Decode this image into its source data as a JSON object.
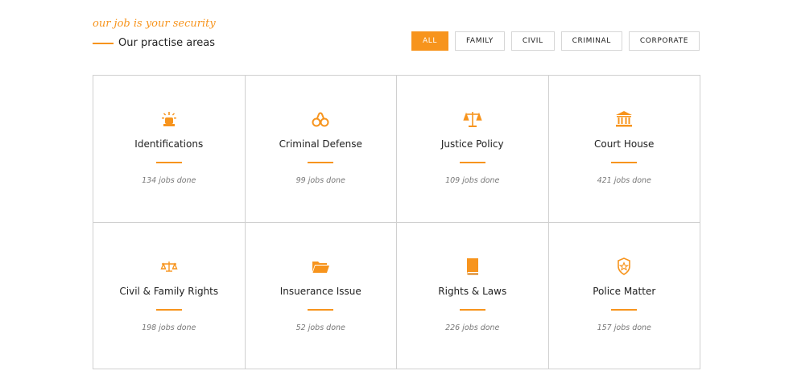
{
  "header": {
    "tagline": "our job is your security",
    "title": "Our practise areas"
  },
  "accent_color": "#f7941d",
  "filters": [
    {
      "label": "ALL",
      "active": true
    },
    {
      "label": "FAMILY",
      "active": false
    },
    {
      "label": "CIVIL",
      "active": false
    },
    {
      "label": "CRIMINAL",
      "active": false
    },
    {
      "label": "CORPORATE",
      "active": false
    }
  ],
  "areas": [
    {
      "title": "Identifications",
      "count": "134 jobs done",
      "icon": "siren-icon"
    },
    {
      "title": "Criminal Defense",
      "count": "99 jobs done",
      "icon": "handcuffs-icon"
    },
    {
      "title": "Justice Policy",
      "count": "109 jobs done",
      "icon": "scales-icon"
    },
    {
      "title": "Court House",
      "count": "421 jobs done",
      "icon": "courthouse-icon"
    },
    {
      "title": "Civil & Family Rights",
      "count": "198 jobs done",
      "icon": "balance-icon"
    },
    {
      "title": "Insuerance Issue",
      "count": "52 jobs done",
      "icon": "folder-icon"
    },
    {
      "title": "Rights & Laws",
      "count": "226 jobs done",
      "icon": "book-icon"
    },
    {
      "title": "Police Matter",
      "count": "157 jobs done",
      "icon": "police-badge-icon"
    }
  ]
}
